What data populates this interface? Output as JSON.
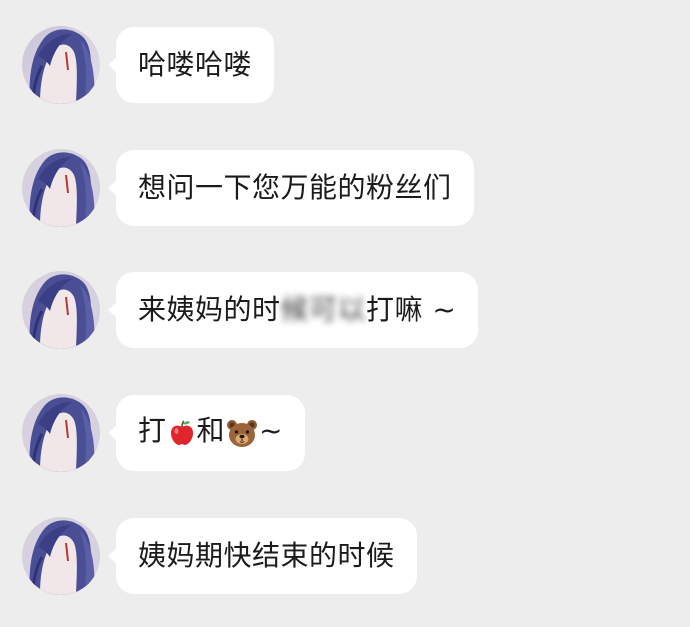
{
  "messages": [
    {
      "sender": "avatar",
      "text": "哈喽哈喽"
    },
    {
      "sender": "avatar",
      "text": "想问一下您万能的粉丝们"
    },
    {
      "sender": "avatar",
      "text_before": "来姨妈的时",
      "text_blurred": "候可以",
      "text_after": "打嘛 ~"
    },
    {
      "sender": "avatar",
      "text_a": "打",
      "emoji_1": "🍎",
      "text_b": "和",
      "emoji_2": "🐻",
      "text_c": "~"
    },
    {
      "sender": "avatar",
      "text": "姨妈期快结束的时候"
    }
  ],
  "icons": {
    "avatar": "anime-avatar-icon",
    "apple": "apple-emoji-icon",
    "bear": "bear-emoji-icon"
  },
  "colors": {
    "background": "#ededed",
    "bubble": "#ffffff",
    "text": "#1b1b1b"
  }
}
